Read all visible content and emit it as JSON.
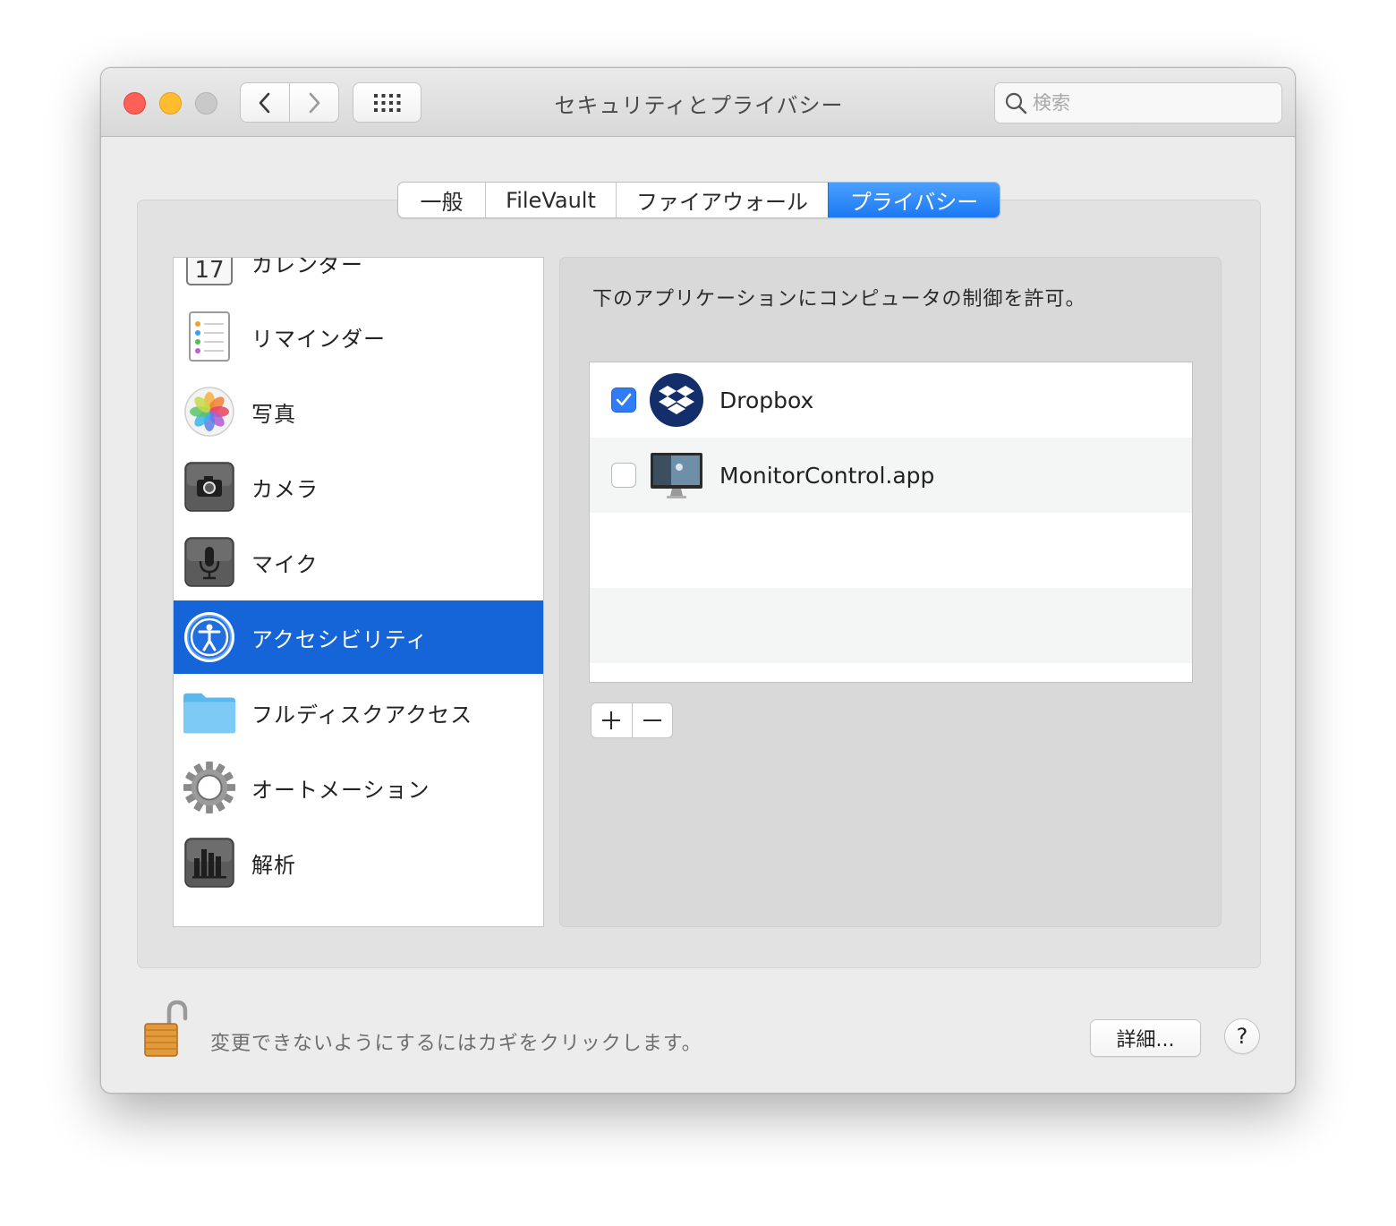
{
  "window": {
    "title": "セキュリティとプライバシー",
    "search_placeholder": "検索"
  },
  "tabs": [
    {
      "label": "一般",
      "active": false
    },
    {
      "label": "FileVault",
      "active": false
    },
    {
      "label": "ファイアウォール",
      "active": false
    },
    {
      "label": "プライバシー",
      "active": true
    }
  ],
  "sidebar": {
    "items": [
      {
        "label": "カレンダー",
        "icon": "calendar-icon"
      },
      {
        "label": "リマインダー",
        "icon": "reminders-icon"
      },
      {
        "label": "写真",
        "icon": "photos-icon"
      },
      {
        "label": "カメラ",
        "icon": "camera-icon"
      },
      {
        "label": "マイク",
        "icon": "microphone-icon"
      },
      {
        "label": "アクセシビリティ",
        "icon": "accessibility-icon",
        "selected": true
      },
      {
        "label": "フルディスクアクセス",
        "icon": "folder-icon"
      },
      {
        "label": "オートメーション",
        "icon": "gear-icon"
      },
      {
        "label": "解析",
        "icon": "analytics-icon"
      }
    ]
  },
  "panel": {
    "description": "下のアプリケーションにコンピュータの制御を許可。",
    "apps": [
      {
        "name": "Dropbox",
        "checked": true,
        "icon": "dropbox-icon"
      },
      {
        "name": "MonitorControl.app",
        "checked": false,
        "icon": "monitor-icon"
      }
    ],
    "add_symbol": "+",
    "remove_symbol": "−"
  },
  "footer": {
    "lock_text": "変更できないようにするにはカギをクリックします。",
    "details_label": "詳細...",
    "help_label": "?"
  },
  "colors": {
    "accent": "#1565d8",
    "tab_active": "#2a83f6",
    "close": "#fe5f57",
    "minimize": "#febc2e",
    "zoom_inactive": "#c9c9c9"
  }
}
